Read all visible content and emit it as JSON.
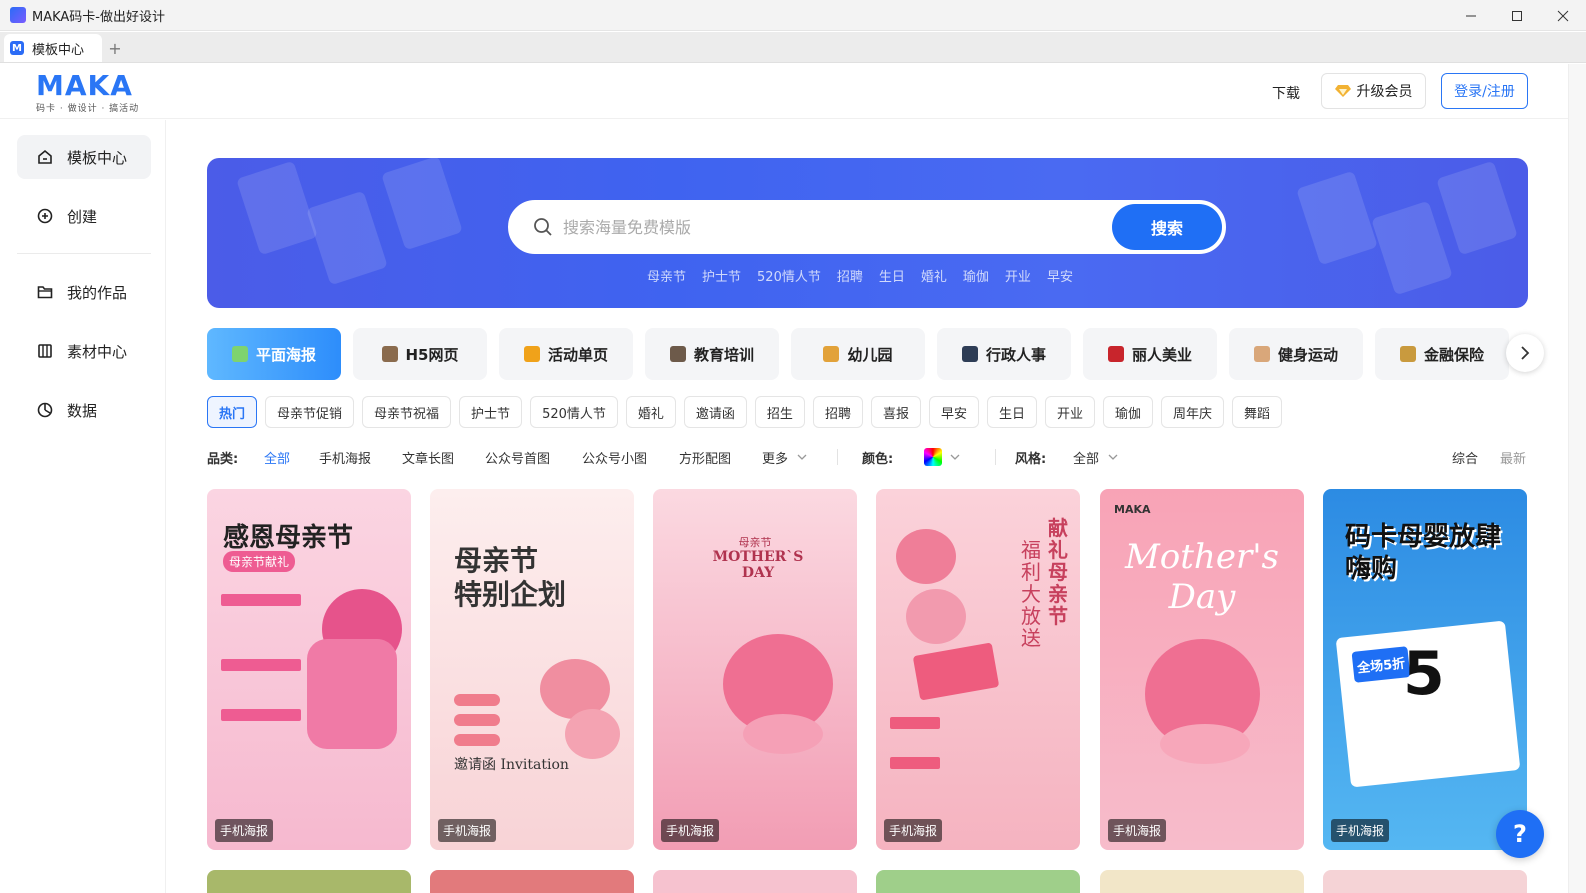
{
  "window": {
    "title": "MAKA码卡-做出好设计"
  },
  "tabs": [
    {
      "label": "模板中心"
    }
  ],
  "header": {
    "logo": "MAKA",
    "logo_sub": "码卡 · 做设计 · 搞活动",
    "download": "下载",
    "vip": "升级会员",
    "login": "登录/注册"
  },
  "sidebar": {
    "items": [
      {
        "label": "模板中心",
        "icon": "home-icon"
      },
      {
        "label": "创建",
        "icon": "plus-circle-icon"
      },
      {
        "label": "我的作品",
        "icon": "folder-icon"
      },
      {
        "label": "素材中心",
        "icon": "book-icon"
      },
      {
        "label": "数据",
        "icon": "chart-icon"
      }
    ]
  },
  "search": {
    "placeholder": "搜索海量免费模版",
    "button": "搜索",
    "hot_words": [
      "母亲节",
      "护士节",
      "520情人节",
      "招聘",
      "生日",
      "婚礼",
      "瑜伽",
      "开业",
      "早安"
    ]
  },
  "categories": [
    {
      "label": "平面海报",
      "color": "#7ed36f"
    },
    {
      "label": "H5网页",
      "color": "#8a6b4e"
    },
    {
      "label": "活动单页",
      "color": "#f0a21a"
    },
    {
      "label": "教育培训",
      "color": "#6d5a4a"
    },
    {
      "label": "幼儿园",
      "color": "#e2a23a"
    },
    {
      "label": "行政人事",
      "color": "#2e3d56"
    },
    {
      "label": "丽人美业",
      "color": "#c8252c"
    },
    {
      "label": "健身运动",
      "color": "#d9a77a"
    },
    {
      "label": "金融保险",
      "color": "#c99a3e"
    }
  ],
  "tags": [
    "热门",
    "母亲节促销",
    "母亲节祝福",
    "护士节",
    "520情人节",
    "婚礼",
    "邀请函",
    "招生",
    "招聘",
    "喜报",
    "早安",
    "生日",
    "开业",
    "瑜伽",
    "周年庆",
    "舞蹈"
  ],
  "filters": {
    "category_label": "品类:",
    "category_options": [
      "全部",
      "手机海报",
      "文章长图",
      "公众号首图",
      "公众号小图",
      "方形配图",
      "更多"
    ],
    "color_label": "颜色:",
    "style_label": "风格:",
    "style_value": "全部",
    "sort_options": [
      "综合",
      "最新"
    ]
  },
  "cards": [
    {
      "label": "手机海报",
      "title": "感恩母亲节",
      "sub": "母亲节献礼",
      "bg": "#f9c6d6"
    },
    {
      "label": "手机海报",
      "title": "母亲节\n特别企划",
      "sub": "邀请函 Invitation",
      "bg": "#fbe3e4"
    },
    {
      "label": "手机海报",
      "title": "MOTHER`S DAY",
      "sub": "母亲节",
      "bg": "#f7b2c1"
    },
    {
      "label": "手机海报",
      "title": "献礼母亲节",
      "sub": "福利大放送",
      "bg": "#f8c5cf"
    },
    {
      "label": "手机海报",
      "title": "Mother's Day",
      "sub": "MAKA",
      "bg": "#f6a6b8"
    },
    {
      "label": "手机海报",
      "title": "码卡母婴放肆嗨购",
      "sub": "全场5折",
      "bg": "#2f8fe0"
    }
  ],
  "help": "?"
}
